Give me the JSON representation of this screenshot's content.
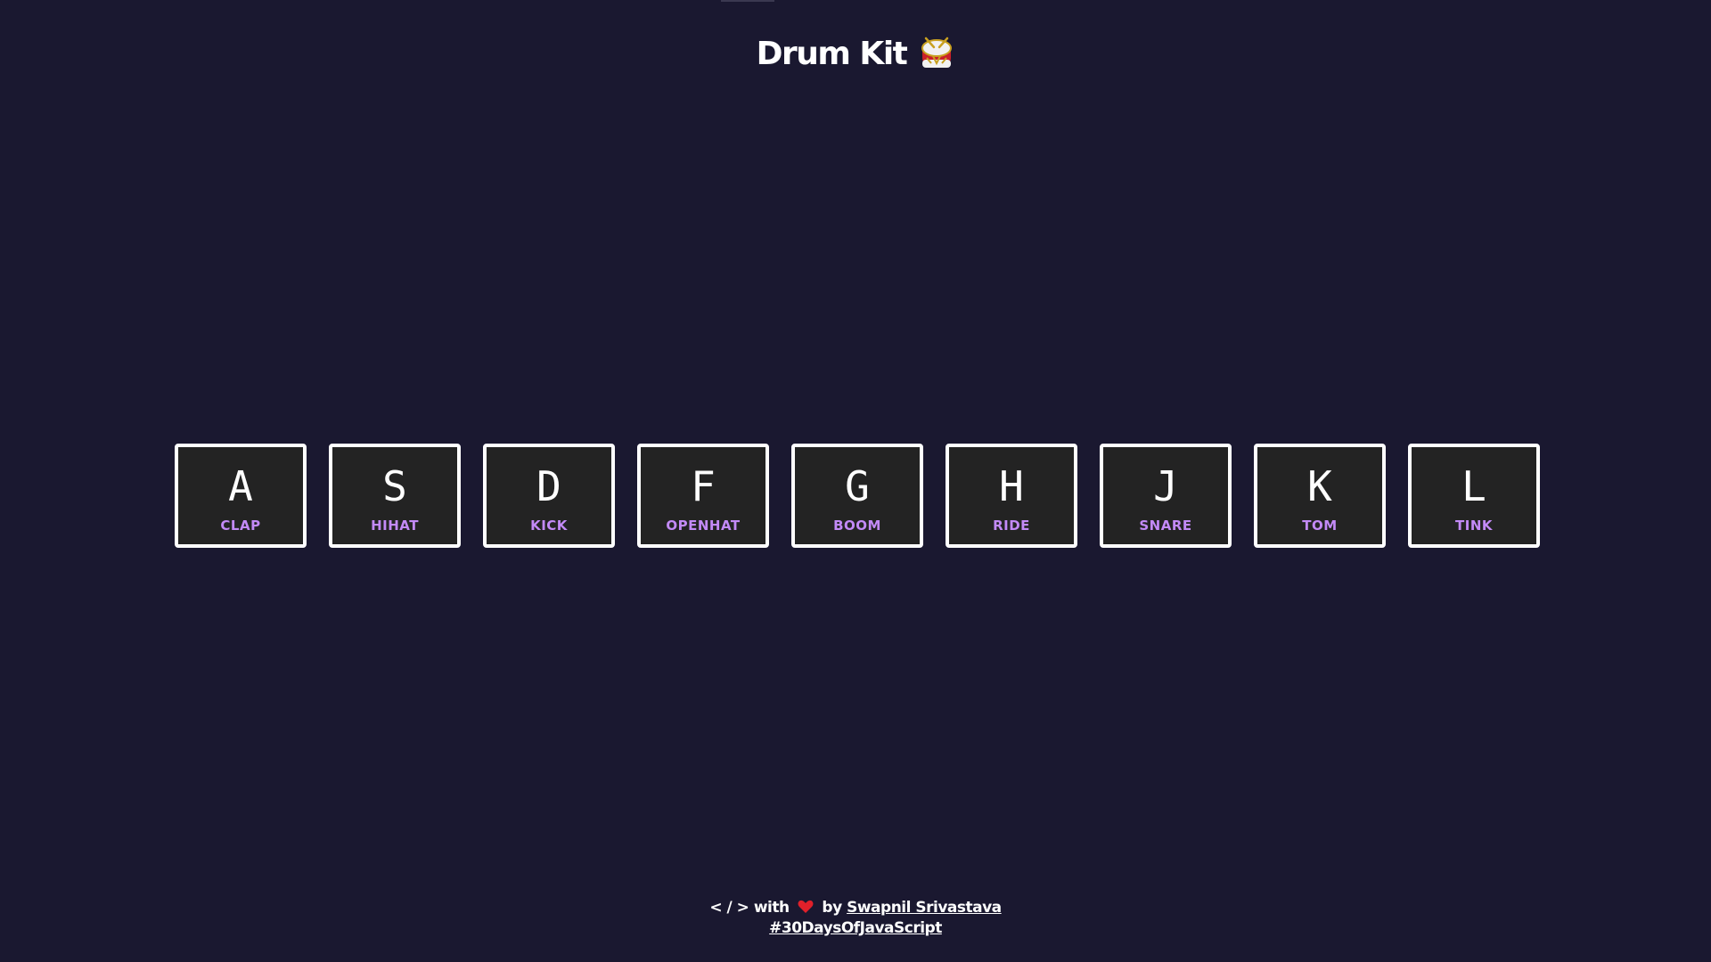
{
  "header": {
    "title": "Drum Kit",
    "icon": "drum-icon"
  },
  "keys": [
    {
      "letter": "A",
      "sound": "CLAP"
    },
    {
      "letter": "S",
      "sound": "HIHAT"
    },
    {
      "letter": "D",
      "sound": "KICK"
    },
    {
      "letter": "F",
      "sound": "OPENHAT"
    },
    {
      "letter": "G",
      "sound": "BOOM"
    },
    {
      "letter": "H",
      "sound": "RIDE"
    },
    {
      "letter": "J",
      "sound": "SNARE"
    },
    {
      "letter": "K",
      "sound": "TOM"
    },
    {
      "letter": "L",
      "sound": "TINK"
    }
  ],
  "footer": {
    "code_symbol": "< / >",
    "with_text": "with",
    "heart_icon": "heart-icon",
    "by_text": "by",
    "author_link": "Swapnil Srivastava",
    "hashtag_link": "#30DaysOfJavaScript"
  },
  "colors": {
    "background": "#1a1830",
    "key_background": "#232323",
    "key_border": "#ffffff",
    "sound_label": "#c38af7",
    "heart": "#e0202a"
  }
}
